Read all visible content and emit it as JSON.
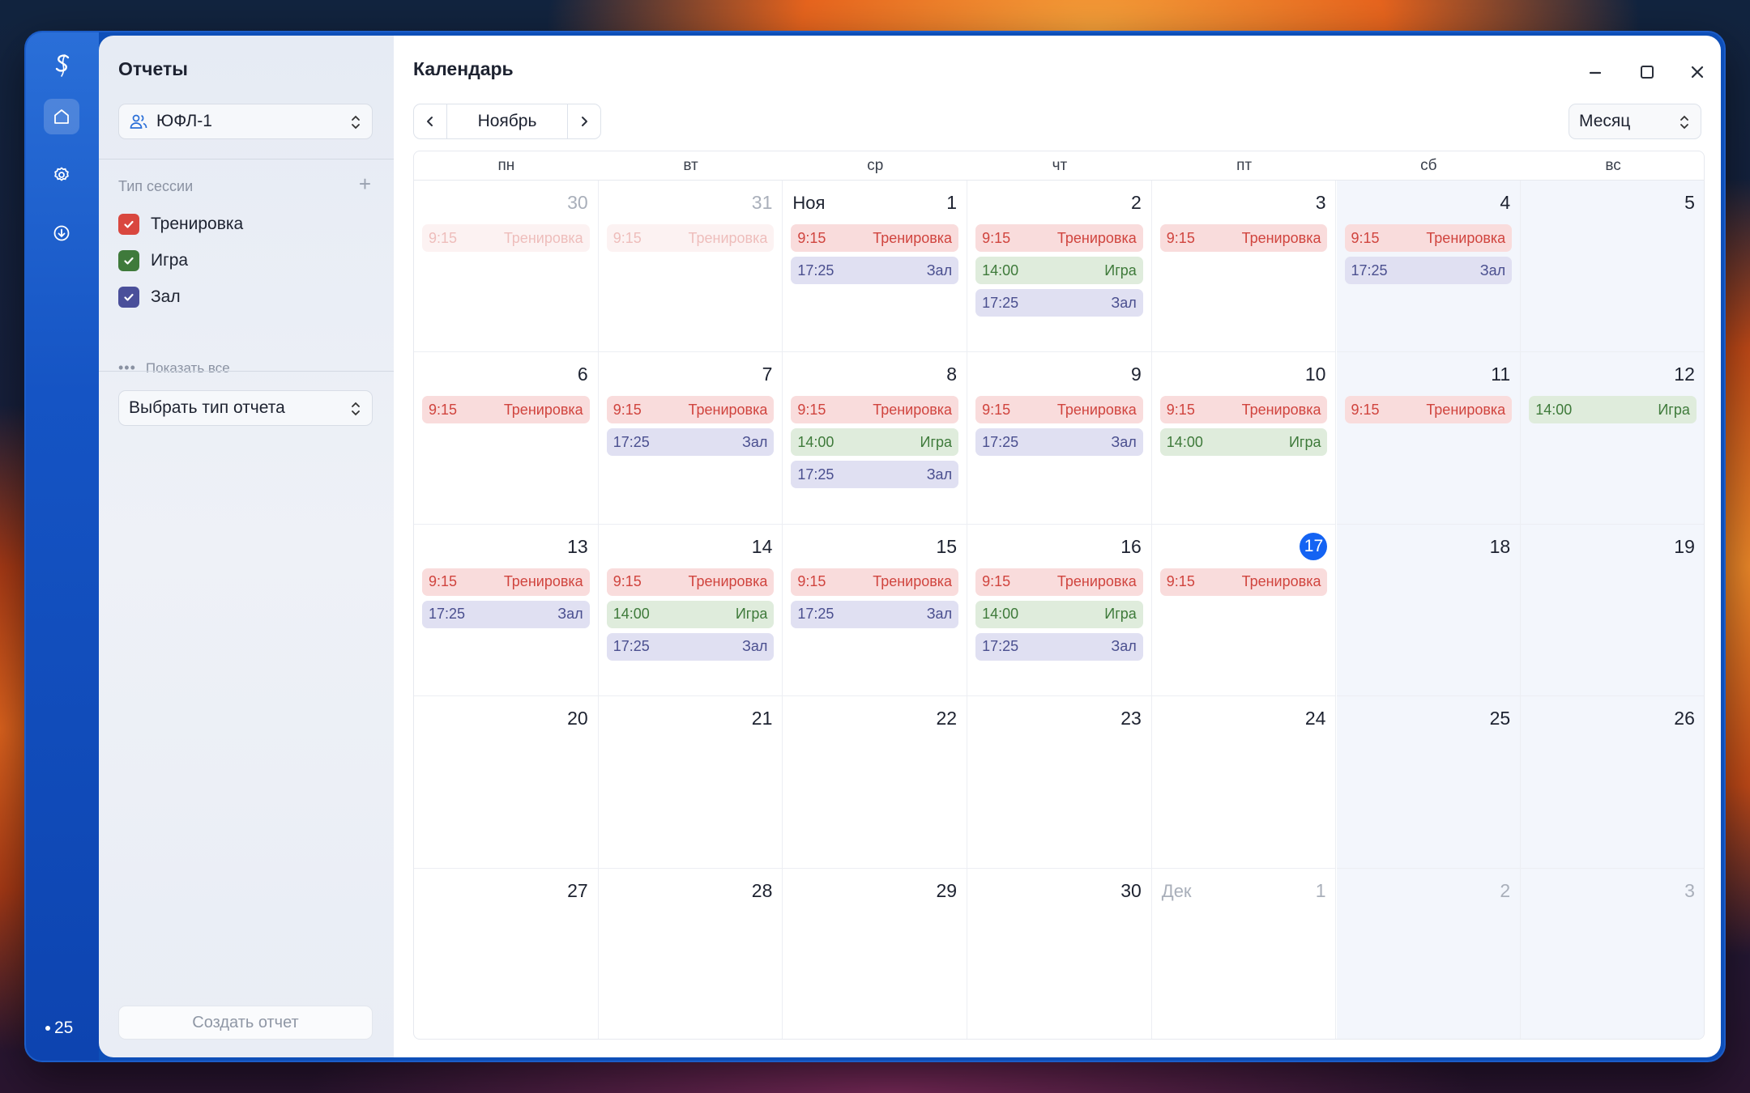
{
  "app": {
    "rail_status": "25",
    "panel_title": "Отчеты",
    "main_title": "Календарь"
  },
  "team_select": {
    "value": "ЮФЛ-1"
  },
  "session_types": {
    "label": "Тип сессии",
    "add": "+",
    "items": [
      {
        "label": "Тренировка",
        "color": "#d9473f",
        "checked": true
      },
      {
        "label": "Игра",
        "color": "#3f7a3b",
        "checked": true
      },
      {
        "label": "Зал",
        "color": "#4a4f9a",
        "checked": true
      }
    ],
    "show_all": "Показать все"
  },
  "report_type_select": {
    "value": "Выбрать тип отчета"
  },
  "create_button": "Создать отчет",
  "calendar": {
    "month_label": "Ноябрь",
    "view": "Месяц",
    "weekdays": [
      "пн",
      "вт",
      "ср",
      "чт",
      "пт",
      "сб",
      "вс"
    ],
    "weeks": [
      [
        {
          "day": "30",
          "dim": true,
          "events": [
            {
              "time": "9:15",
              "title": "Тренировка",
              "type": "train"
            }
          ]
        },
        {
          "day": "31",
          "dim": true,
          "events": [
            {
              "time": "9:15",
              "title": "Тренировка",
              "type": "train"
            }
          ]
        },
        {
          "day": "1",
          "month": "Ноя",
          "events": [
            {
              "time": "9:15",
              "title": "Тренировка",
              "type": "train"
            },
            {
              "time": "17:25",
              "title": "Зал",
              "type": "gym"
            }
          ]
        },
        {
          "day": "2",
          "events": [
            {
              "time": "9:15",
              "title": "Тренировка",
              "type": "train"
            },
            {
              "time": "14:00",
              "title": "Игра",
              "type": "game"
            },
            {
              "time": "17:25",
              "title": "Зал",
              "type": "gym"
            }
          ]
        },
        {
          "day": "3",
          "events": [
            {
              "time": "9:15",
              "title": "Тренировка",
              "type": "train"
            }
          ]
        },
        {
          "day": "4",
          "events": [
            {
              "time": "9:15",
              "title": "Тренировка",
              "type": "train"
            },
            {
              "time": "17:25",
              "title": "Зал",
              "type": "gym"
            }
          ]
        },
        {
          "day": "5",
          "events": []
        }
      ],
      [
        {
          "day": "6",
          "events": [
            {
              "time": "9:15",
              "title": "Тренировка",
              "type": "train"
            }
          ]
        },
        {
          "day": "7",
          "events": [
            {
              "time": "9:15",
              "title": "Тренировка",
              "type": "train"
            },
            {
              "time": "17:25",
              "title": "Зал",
              "type": "gym"
            }
          ]
        },
        {
          "day": "8",
          "events": [
            {
              "time": "9:15",
              "title": "Тренировка",
              "type": "train"
            },
            {
              "time": "14:00",
              "title": "Игра",
              "type": "game"
            },
            {
              "time": "17:25",
              "title": "Зал",
              "type": "gym"
            }
          ]
        },
        {
          "day": "9",
          "events": [
            {
              "time": "9:15",
              "title": "Тренировка",
              "type": "train"
            },
            {
              "time": "17:25",
              "title": "Зал",
              "type": "gym"
            }
          ]
        },
        {
          "day": "10",
          "events": [
            {
              "time": "9:15",
              "title": "Тренировка",
              "type": "train"
            },
            {
              "time": "14:00",
              "title": "Игра",
              "type": "game"
            }
          ]
        },
        {
          "day": "11",
          "events": [
            {
              "time": "9:15",
              "title": "Тренировка",
              "type": "train"
            }
          ]
        },
        {
          "day": "12",
          "events": [
            {
              "time": "14:00",
              "title": "Игра",
              "type": "game"
            }
          ]
        }
      ],
      [
        {
          "day": "13",
          "events": [
            {
              "time": "9:15",
              "title": "Тренировка",
              "type": "train"
            },
            {
              "time": "17:25",
              "title": "Зал",
              "type": "gym"
            }
          ]
        },
        {
          "day": "14",
          "events": [
            {
              "time": "9:15",
              "title": "Тренировка",
              "type": "train"
            },
            {
              "time": "14:00",
              "title": "Игра",
              "type": "game"
            },
            {
              "time": "17:25",
              "title": "Зал",
              "type": "gym"
            }
          ]
        },
        {
          "day": "15",
          "events": [
            {
              "time": "9:15",
              "title": "Тренировка",
              "type": "train"
            },
            {
              "time": "17:25",
              "title": "Зал",
              "type": "gym"
            }
          ]
        },
        {
          "day": "16",
          "events": [
            {
              "time": "9:15",
              "title": "Тренировка",
              "type": "train"
            },
            {
              "time": "14:00",
              "title": "Игра",
              "type": "game"
            },
            {
              "time": "17:25",
              "title": "Зал",
              "type": "gym"
            }
          ]
        },
        {
          "day": "17",
          "today": true,
          "events": [
            {
              "time": "9:15",
              "title": "Тренировка",
              "type": "train"
            }
          ]
        },
        {
          "day": "18",
          "events": []
        },
        {
          "day": "19",
          "events": []
        }
      ],
      [
        {
          "day": "20",
          "events": []
        },
        {
          "day": "21",
          "events": []
        },
        {
          "day": "22",
          "events": []
        },
        {
          "day": "23",
          "events": []
        },
        {
          "day": "24",
          "events": []
        },
        {
          "day": "25",
          "events": []
        },
        {
          "day": "26",
          "events": []
        }
      ],
      [
        {
          "day": "27",
          "events": []
        },
        {
          "day": "28",
          "events": []
        },
        {
          "day": "29",
          "events": []
        },
        {
          "day": "30",
          "events": []
        },
        {
          "day": "1",
          "month": "Дек",
          "dim": true,
          "events": []
        },
        {
          "day": "2",
          "dim": true,
          "events": []
        },
        {
          "day": "3",
          "dim": true,
          "events": []
        }
      ]
    ]
  }
}
